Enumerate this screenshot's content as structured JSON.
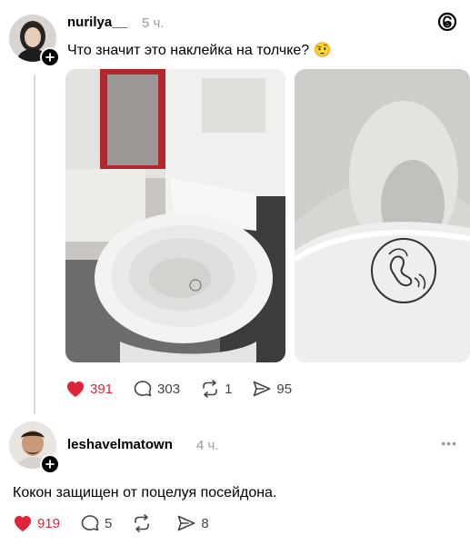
{
  "post": {
    "username": "nurilya__",
    "time": "5 ч.",
    "text": "Что значит это наклейка на толчке? 🤨",
    "likes": "391",
    "comments": "303",
    "reposts": "1",
    "shares": "95"
  },
  "reply": {
    "username": "leshavelmatown",
    "time": "4 ч.",
    "text": "Кокон защищен от поцелуя посейдона.",
    "likes": "919",
    "comments": "5",
    "reposts": "",
    "shares": "8"
  },
  "icons": {
    "logo": "threads-logo-icon",
    "like": "heart-icon",
    "comment": "comment-bubble-icon",
    "repost": "repost-icon",
    "share": "send-icon",
    "more": "more-dots-icon",
    "follow": "plus-icon"
  },
  "colors": {
    "like": "#e0243a",
    "muted": "#9a9a9a",
    "thread_line": "#d9d9d9"
  }
}
